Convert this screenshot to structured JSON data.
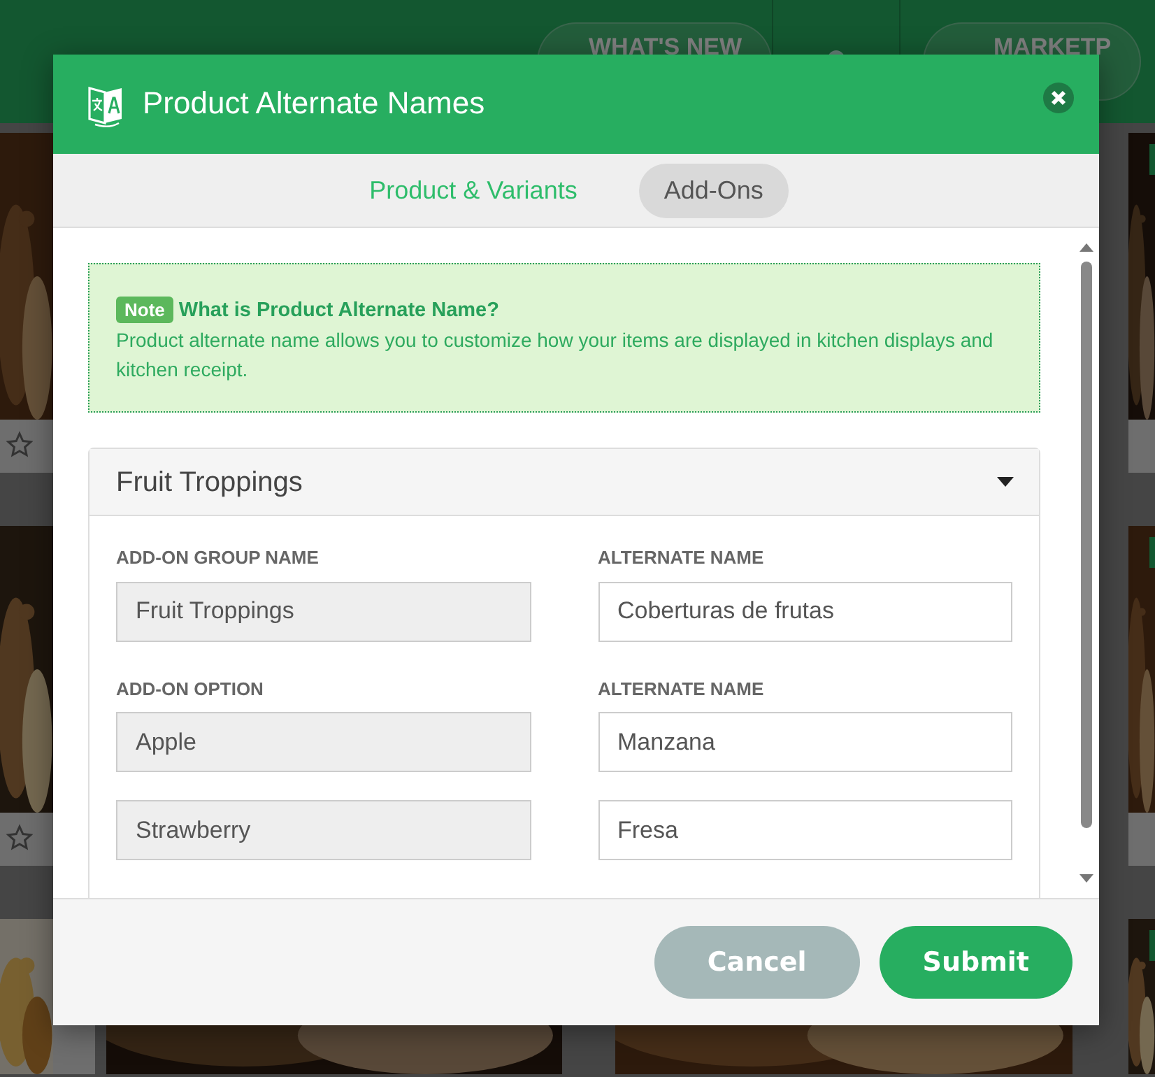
{
  "header": {
    "buttons": [
      {
        "label": "WHAT'S NEW",
        "kind": "pill"
      },
      {
        "kind": "bell"
      },
      {
        "label": "MARKETP",
        "kind": "store"
      }
    ]
  },
  "modal": {
    "title": "Product Alternate Names",
    "tabs": [
      {
        "label": "Product & Variants",
        "selected": false
      },
      {
        "label": "Add-Ons",
        "selected": true
      }
    ],
    "note": {
      "badge": "Note",
      "heading": "What is Product Alternate Name?",
      "text": "Product alternate name allows you to customize how your items are displayed in kitchen displays and kitchen receipt."
    },
    "groups": [
      {
        "title": "Fruit Troppings",
        "expanded": true,
        "group_label": "ADD-ON GROUP NAME",
        "group_alt_label": "ALTERNATE NAME",
        "name": "Fruit Troppings",
        "alternate": "Coberturas de frutas",
        "option_label": "ADD-ON OPTION",
        "option_alt_label": "ALTERNATE NAME",
        "options": [
          {
            "name": "Apple",
            "alternate": "Manzana"
          },
          {
            "name": "Strawberry",
            "alternate": "Fresa"
          }
        ]
      }
    ],
    "buttons": [
      {
        "label": "Cancel",
        "kind": "secondary"
      },
      {
        "label": "Submit",
        "kind": "primary"
      }
    ]
  }
}
